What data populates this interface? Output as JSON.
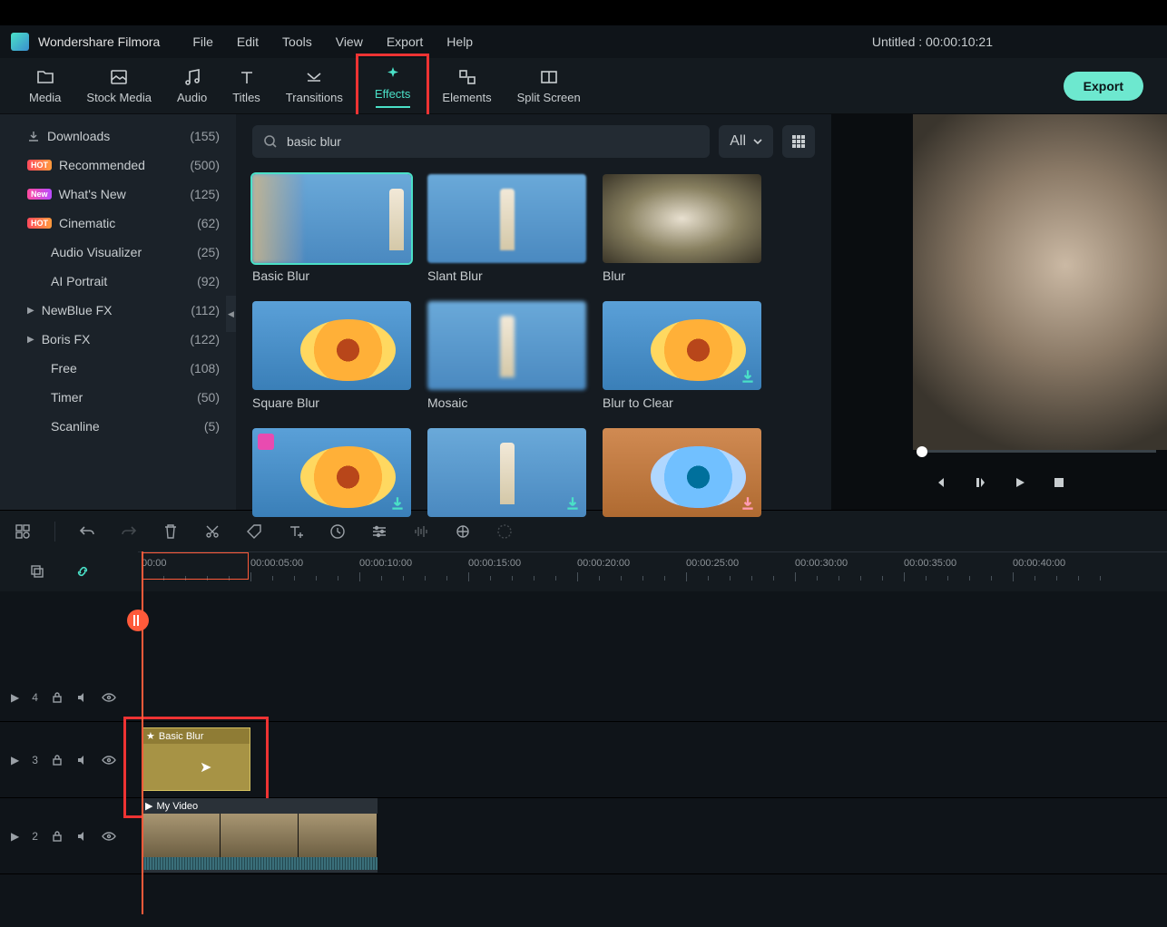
{
  "app": {
    "title": "Wondershare Filmora",
    "project": "Untitled : 00:00:10:21"
  },
  "menu": {
    "file": "File",
    "edit": "Edit",
    "tools": "Tools",
    "view": "View",
    "export": "Export",
    "help": "Help"
  },
  "tabs": {
    "media": "Media",
    "stock": "Stock Media",
    "audio": "Audio",
    "titles": "Titles",
    "transitions": "Transitions",
    "effects": "Effects",
    "elements": "Elements",
    "split": "Split Screen",
    "export_btn": "Export"
  },
  "sidebar": {
    "items": [
      {
        "label": "Downloads",
        "count": "(155)",
        "icon": "download"
      },
      {
        "label": "Recommended",
        "count": "(500)",
        "badge": "HOT"
      },
      {
        "label": "What's New",
        "count": "(125)",
        "badge": "New"
      },
      {
        "label": "Cinematic",
        "count": "(62)",
        "badge": "HOT"
      },
      {
        "label": "Audio Visualizer",
        "count": "(25)"
      },
      {
        "label": "AI Portrait",
        "count": "(92)"
      },
      {
        "label": "NewBlue FX",
        "count": "(112)",
        "caret": true
      },
      {
        "label": "Boris FX",
        "count": "(122)",
        "caret": true
      },
      {
        "label": "Free",
        "count": "(108)"
      },
      {
        "label": "Timer",
        "count": "(50)"
      },
      {
        "label": "Scanline",
        "count": "(5)"
      }
    ]
  },
  "search": {
    "value": "basic blur",
    "filter": "All"
  },
  "effects": [
    {
      "label": "Basic Blur"
    },
    {
      "label": "Slant Blur"
    },
    {
      "label": "Blur"
    },
    {
      "label": "Square Blur"
    },
    {
      "label": "Mosaic"
    },
    {
      "label": "Blur to Clear"
    }
  ],
  "ruler": {
    "labels": [
      "00:00",
      "00:00:05:00",
      "00:00:10:00",
      "00:00:15:00",
      "00:00:20:00",
      "00:00:25:00",
      "00:00:30:00",
      "00:00:35:00",
      "00:00:40:00"
    ]
  },
  "tracks": {
    "t4": "4",
    "t3": "3",
    "t2": "2",
    "effect_clip": "Basic Blur",
    "video_clip": "My Video"
  }
}
